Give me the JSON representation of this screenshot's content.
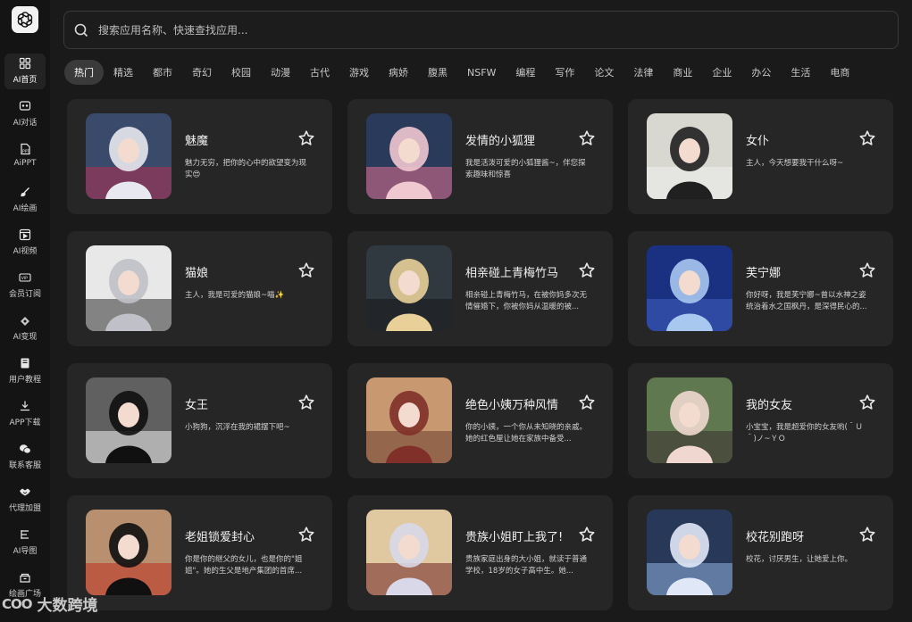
{
  "app": {
    "logo_icon": "openai-logo-icon"
  },
  "sidebar": {
    "items": [
      {
        "label": "AI首页",
        "icon": "grid-icon",
        "active": true
      },
      {
        "label": "AI对话",
        "icon": "chat-icon",
        "active": false
      },
      {
        "label": "AiPPT",
        "icon": "ppt-icon",
        "active": false
      },
      {
        "label": "AI绘画",
        "icon": "brush-icon",
        "active": false
      },
      {
        "label": "AI视频",
        "icon": "video-icon",
        "active": false
      },
      {
        "label": "会员订阅",
        "icon": "vip-icon",
        "active": false
      },
      {
        "label": "AI变现",
        "icon": "money-icon",
        "active": false
      },
      {
        "label": "用户教程",
        "icon": "book-icon",
        "active": false
      },
      {
        "label": "APP下载",
        "icon": "download-icon",
        "active": false
      },
      {
        "label": "联系客服",
        "icon": "wechat-icon",
        "active": false
      },
      {
        "label": "代理加盟",
        "icon": "handshake-icon",
        "active": false
      },
      {
        "label": "AI导图",
        "icon": "mindmap-icon",
        "active": false
      },
      {
        "label": "绘画广场",
        "icon": "gallery-icon",
        "active": false
      }
    ]
  },
  "search": {
    "placeholder": "搜索应用名称、快速查找应用..."
  },
  "tabs": [
    "热门",
    "精选",
    "都市",
    "奇幻",
    "校园",
    "动漫",
    "古代",
    "游戏",
    "病娇",
    "腹黑",
    "NSFW",
    "编程",
    "写作",
    "论文",
    "法律",
    "商业",
    "企业",
    "办公",
    "生活",
    "电商"
  ],
  "active_tab": "热门",
  "cards": [
    {
      "title": "魅魔",
      "desc": "魅力无穷，把你的心中的欲望变为现实😍",
      "palette": [
        "#3a4a6a",
        "#e8e8f0",
        "#b03050"
      ]
    },
    {
      "title": "发情的小狐狸",
      "desc": "我是活泼可爱的小狐狸酱~，伴您探索趣味和惊喜",
      "palette": [
        "#2a3a5a",
        "#f0c8d0",
        "#e07090"
      ]
    },
    {
      "title": "女仆",
      "desc": "主人，今天想要我干什么呀~",
      "palette": [
        "#d8d8d0",
        "#202020",
        "#f0f0f0"
      ]
    },
    {
      "title": "猫娘",
      "desc": "主人，我是可爱的猫娘~喵✨",
      "palette": [
        "#e8e8e8",
        "#c0c0c8",
        "#303030"
      ]
    },
    {
      "title": "相亲碰上青梅竹马",
      "desc": "相亲碰上青梅竹马，在被你妈多次无情催婚下，你被你妈从温暖的被...",
      "palette": [
        "#303840",
        "#e8d098",
        "#181818"
      ]
    },
    {
      "title": "芙宁娜",
      "desc": "你好呀，我是芙宁娜~曾以水神之姿统治着水之国枫丹，是深得民心的...",
      "palette": [
        "#1a3080",
        "#a8c8f0",
        "#4060c0"
      ]
    },
    {
      "title": "女王",
      "desc": "小狗狗，沉浮在我的裙摆下吧~",
      "palette": [
        "#606060",
        "#101010",
        "#f0f0f0"
      ]
    },
    {
      "title": "绝色小姨万种风情",
      "desc": "你的小姨，一个你从未知晓的亲戚。她的红色厘让她在家族中备受...",
      "palette": [
        "#c89870",
        "#803028",
        "#6a4030"
      ]
    },
    {
      "title": "我的女友",
      "desc": "小宝宝，我是超爱你的女友哟(＾Ｕ＾)ノ~ＹＯ",
      "palette": [
        "#607850",
        "#f0d8d0",
        "#3a3030"
      ]
    },
    {
      "title": "老姐锁爱封心",
      "desc": "你是你的继父的女儿，也是你的\"姐姐\"。她的生父是地产集团的首席...",
      "palette": [
        "#b89070",
        "#101010",
        "#c03020"
      ]
    },
    {
      "title": "贵族小姐盯上我了!",
      "desc": "贵族家庭出身的大小姐，就读于普通学校，18岁的女子高中生。她...",
      "palette": [
        "#e0c8a0",
        "#d8d8e8",
        "#702020"
      ]
    },
    {
      "title": "校花别跑呀",
      "desc": "校花，讨厌男生，让她爱上你。",
      "palette": [
        "#283858",
        "#e0e8f8",
        "#90b0e0"
      ]
    }
  ],
  "watermark": {
    "mark": "COO",
    "text": "大数跨境"
  }
}
